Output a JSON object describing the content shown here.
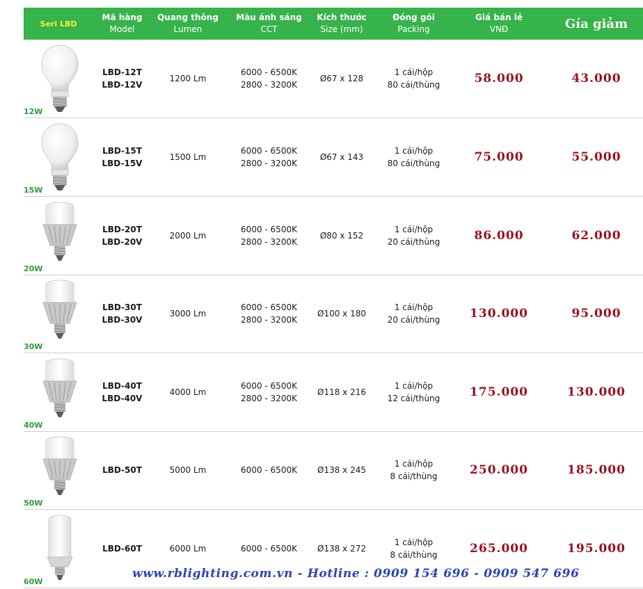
{
  "header": {
    "seri": "Seri LBD",
    "model_l1": "Mã hàng",
    "model_l2": "Model",
    "lumen_l1": "Quang thông",
    "lumen_l2": "Lumen",
    "cct_l1": "Màu ánh sáng",
    "cct_l2": "CCT",
    "size_l1": "Kích thước",
    "size_l2": "Size (mm)",
    "pack_l1": "Đóng gói",
    "pack_l2": "Packing",
    "retail_l1": "Giá bán lẻ",
    "retail_l2": "VNĐ",
    "discount": "Gía giảm"
  },
  "rows": [
    {
      "watt": "12W",
      "bulb": "round-bulb-icon",
      "model1": "LBD-12T",
      "model2": "LBD-12V",
      "lumen": "1200 Lm",
      "cct1": "6000 - 6500K",
      "cct2": "2800 - 3200K",
      "size": "Ø67 x 128",
      "pack1": "1 cái/hộp",
      "pack2": "80 cái/thùng",
      "retail": "58.000",
      "discount": "43.000"
    },
    {
      "watt": "15W",
      "bulb": "round-bulb-icon",
      "model1": "LBD-15T",
      "model2": "LBD-15V",
      "lumen": "1500 Lm",
      "cct1": "6000 - 6500K",
      "cct2": "2800 - 3200K",
      "size": "Ø67 x 143",
      "pack1": "1 cái/hộp",
      "pack2": "80 cái/thùng",
      "retail": "75.000",
      "discount": "55.000"
    },
    {
      "watt": "20W",
      "bulb": "finned-bulb-icon",
      "model1": "LBD-20T",
      "model2": "LBD-20V",
      "lumen": "2000 Lm",
      "cct1": "6000 - 6500K",
      "cct2": "2800 - 3200K",
      "size": "Ø80 x 152",
      "pack1": "1 cái/hộp",
      "pack2": "20 cái/thùng",
      "retail": "86.000",
      "discount": "62.000"
    },
    {
      "watt": "30W",
      "bulb": "finned-bulb-icon",
      "model1": "LBD-30T",
      "model2": "LBD-30V",
      "lumen": "3000 Lm",
      "cct1": "6000 - 6500K",
      "cct2": "2800 - 3200K",
      "size": "Ø100 x 180",
      "pack1": "1 cái/hộp",
      "pack2": "20 cái/thùng",
      "retail": "130.000",
      "discount": "95.000"
    },
    {
      "watt": "40W",
      "bulb": "finned-bulb-icon",
      "model1": "LBD-40T",
      "model2": "LBD-40V",
      "lumen": "4000 Lm",
      "cct1": "6000 - 6500K",
      "cct2": "2800 - 3200K",
      "size": "Ø118 x 216",
      "pack1": "1 cái/hộp",
      "pack2": "12 cái/thùng",
      "retail": "175.000",
      "discount": "130.000"
    },
    {
      "watt": "50W",
      "bulb": "finned-bulb-icon",
      "model1": "LBD-50T",
      "model2": "",
      "lumen": "5000 Lm",
      "cct1": "6000 - 6500K",
      "cct2": "",
      "size": "Ø138 x 245",
      "pack1": "1 cái/hộp",
      "pack2": "8 cái/thùng",
      "retail": "250.000",
      "discount": "185.000"
    },
    {
      "watt": "60W",
      "bulb": "cylinder-bulb-icon",
      "model1": "LBD-60T",
      "model2": "",
      "lumen": "6000 Lm",
      "cct1": "6000 - 6500K",
      "cct2": "",
      "size": "Ø138 x 272",
      "pack1": "1 cái/hộp",
      "pack2": "8 cái/thùng",
      "retail": "265.000",
      "discount": "195.000"
    }
  ],
  "footer": "www.rblighting.com.vn - Hotline : 0909 154 696 - 0909 547 696",
  "colors": {
    "header_bg": "#36b34a",
    "price": "#9a0f1d",
    "footer": "#2b45b8",
    "watt": "#2f9a3e"
  }
}
